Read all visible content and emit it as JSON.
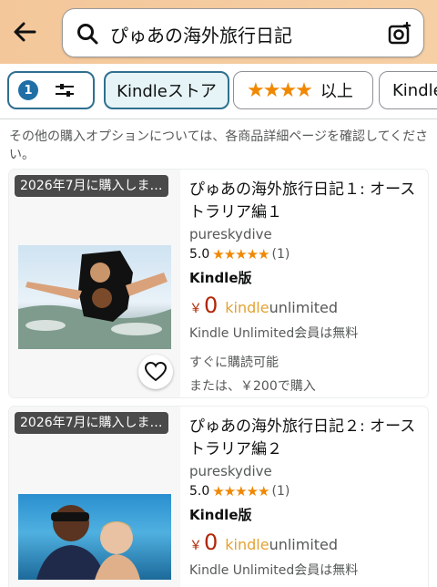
{
  "header": {
    "search_query": "ぴゅあの海外旅行日記"
  },
  "filters": {
    "active_count": "1",
    "chips": [
      {
        "label": "Kindleストア",
        "selected": true
      },
      {
        "label": "以上",
        "stars": "★★★★"
      },
      {
        "label": "Kindle"
      }
    ]
  },
  "notice": "その他の購入オプションについては、各商品詳細ページを確認してください。",
  "results": [
    {
      "badge": "2026年7月に購入しま…",
      "title": "ぴゅあの海外旅行日記１: オーストラリア編１",
      "author": "pureskydive",
      "rating": "5.0",
      "stars": "★★★★★",
      "review_count": "(1)",
      "format": "Kindle版",
      "currency": "￥",
      "price": "0",
      "ku_logo_a": "kindle",
      "ku_logo_b": "unlimited",
      "ku_note": "Kindle Unlimited会員は無料",
      "availability": "すぐに購読可能",
      "alt_price": "または、￥200で購入"
    },
    {
      "badge": "2026年7月に購入しま…",
      "title": "ぴゅあの海外旅行日記２: オーストラリア編２",
      "author": "pureskydive",
      "rating": "5.0",
      "stars": "★★★★★",
      "review_count": "(1)",
      "format": "Kindle版",
      "currency": "￥",
      "price": "0",
      "ku_logo_a": "kindle",
      "ku_logo_b": "unlimited",
      "ku_note": "Kindle Unlimited会員は無料"
    }
  ],
  "colors": {
    "header_bg": "#f3c79a",
    "price": "#b12704",
    "star": "#f08804",
    "chip_accent": "#2f6f8f"
  }
}
